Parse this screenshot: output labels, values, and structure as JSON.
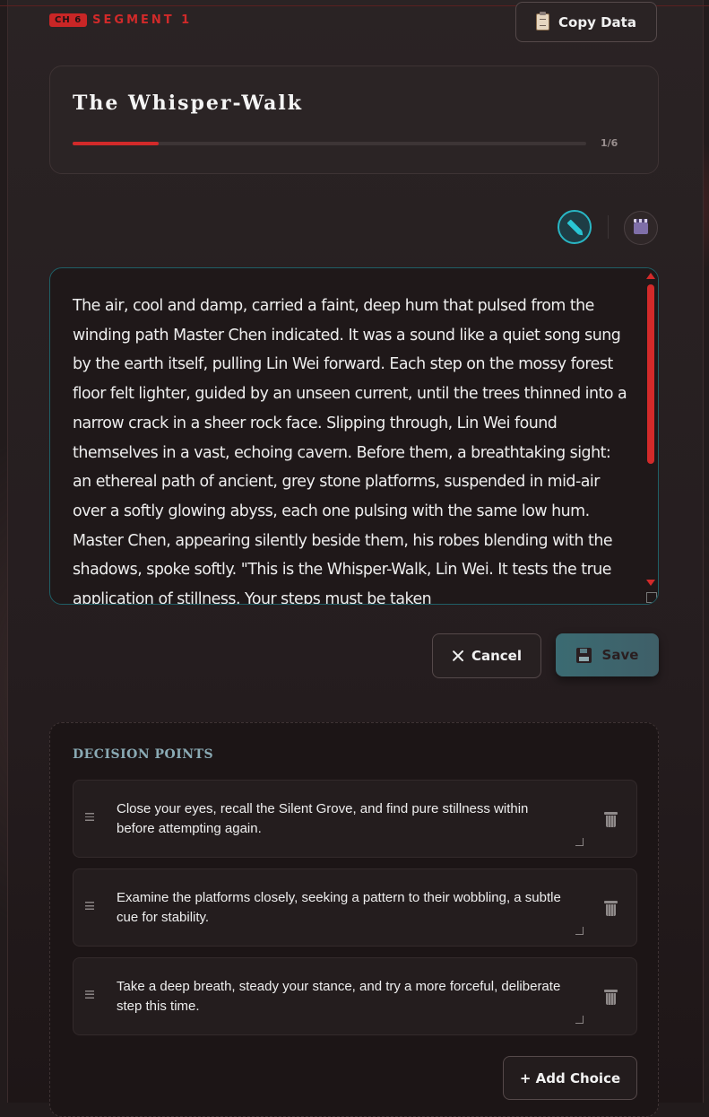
{
  "header": {
    "chapter_badge": "CH 6",
    "segment_label": "SEGMENT 1",
    "copy_button_label": "Copy Data"
  },
  "story": {
    "title": "The Whisper-Walk",
    "progress_label": "1/6",
    "progress_fraction": 0.167
  },
  "editor": {
    "text": "The air, cool and damp, carried a faint, deep hum that pulsed from the winding path Master Chen indicated. It was a sound like a quiet song sung by the earth itself, pulling Lin Wei forward. Each step on the mossy forest floor felt lighter, guided by an unseen current, until the trees thinned into a narrow crack in a sheer rock face. Slipping through, Lin Wei found themselves in a vast, echoing cavern. Before them, a breathtaking sight: an ethereal path of ancient, grey stone platforms, suspended in mid-air over a softly glowing abyss, each one pulsing with the same low hum. Master Chen, appearing silently beside them, his robes blending with the shadows, spoke softly. \"This is the Whisper-Walk, Lin Wei. It tests the true application of stillness. Your steps must be taken"
  },
  "actions": {
    "cancel_label": "Cancel",
    "save_label": "Save"
  },
  "decisions": {
    "title": "DECISION POINTS",
    "choices": [
      "Close your eyes, recall the Silent Grove, and find pure stillness within before attempting again.",
      "Examine the platforms closely, seeking a pattern to their wobbling, a subtle cue for stability.",
      "Take a deep breath, steady your stance, and try a more forceful, deliberate step this time."
    ],
    "add_choice_label": "+ Add Choice"
  },
  "colors": {
    "accent_red": "#d22a2a",
    "accent_teal": "#29b6c4",
    "background": "#221b1c"
  },
  "icons": {
    "copy": "clipboard-icon",
    "edit_mode": "pencil-icon",
    "preview_mode": "clapperboard-icon",
    "cancel": "close-icon",
    "save": "floppy-disk-icon",
    "drag": "drag-handle-icon",
    "delete": "trash-icon"
  }
}
